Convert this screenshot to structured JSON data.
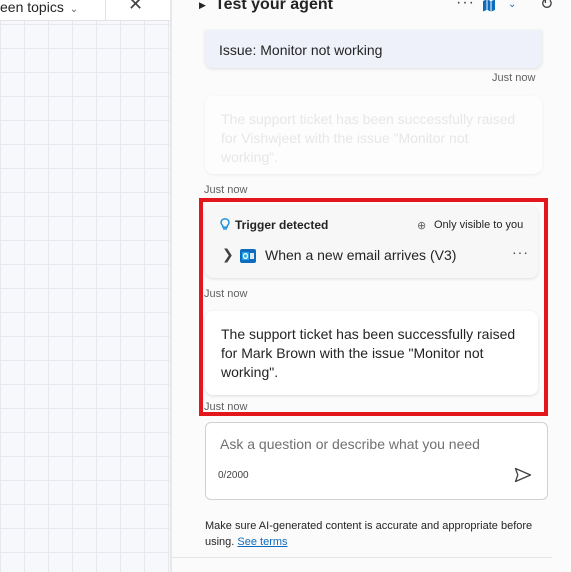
{
  "left_pane": {
    "topics_label": "een topics",
    "close_icon": "close-icon"
  },
  "agent_panel": {
    "title": "Test your agent",
    "more_options_icon": "more-icon",
    "map_icon": "map-icon",
    "refresh_icon": "refresh-icon"
  },
  "conversation": {
    "user_message": "Issue: Monitor not working",
    "user_timestamp": "Just now",
    "previous_reply": "The support ticket has been successfully raised for Vishwjeet with the issue \"Monitor not working\".",
    "previous_timestamp": "Just now",
    "trigger": {
      "label": "Trigger detected",
      "visibility": "Only visible to you",
      "flow_name": "When a new email arrives (V3)",
      "timestamp": "Just now"
    },
    "reply": "The support ticket has been successfully raised for Mark Brown with the issue \"Monitor not working\".",
    "reply_timestamp": "Just now"
  },
  "composer": {
    "placeholder": "Ask a question or describe what you need",
    "counter": "0/2000"
  },
  "disclaimer": {
    "text": "Make sure AI-generated content is accurate and appropriate before using.",
    "link": "See terms"
  },
  "colors": {
    "accent": "#0f6cbd",
    "highlight": "#e3161b",
    "bulb": "#0f8ad9"
  }
}
